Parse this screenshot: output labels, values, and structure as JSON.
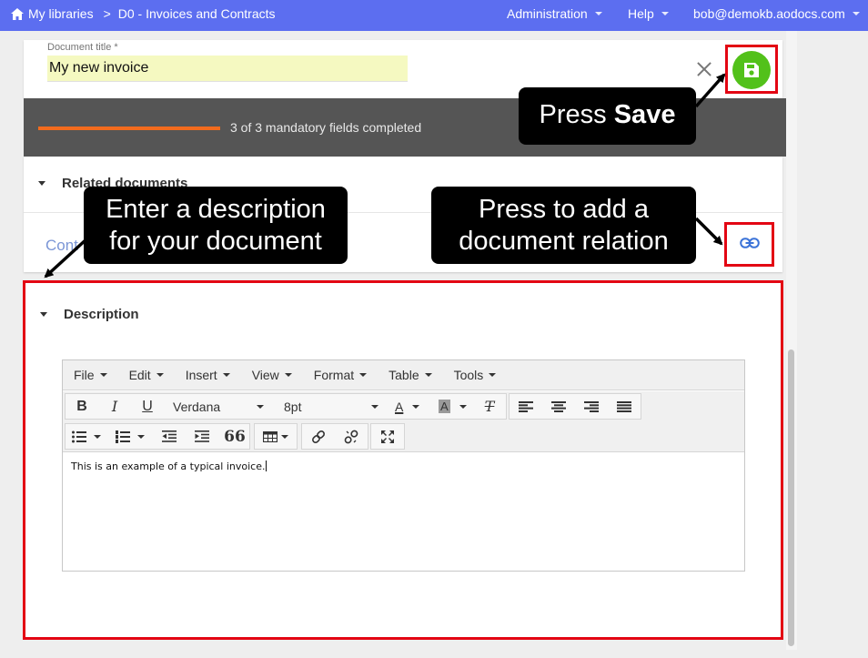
{
  "topbar": {
    "breadcrumb_home": "My libraries",
    "breadcrumb_separator": ">",
    "breadcrumb_library": "D0 - Invoices and Contracts",
    "nav_administration": "Administration",
    "nav_help": "Help",
    "user_email": "bob@demokb.aodocs.com"
  },
  "document": {
    "title_label": "Document title *",
    "title_value": "My new invoice"
  },
  "progress": {
    "text": "3 of 3 mandatory fields completed",
    "completed": 3,
    "total": 3,
    "fill_color": "#f26b1d"
  },
  "related": {
    "heading": "Related documents",
    "link_text": "Cont"
  },
  "description": {
    "heading": "Description",
    "content": "This is an example of a typical invoice."
  },
  "editor": {
    "menu": [
      "File",
      "Edit",
      "Insert",
      "View",
      "Format",
      "Table",
      "Tools"
    ],
    "font_family": "Verdana",
    "font_size": "8pt",
    "bold": "B",
    "italic": "I",
    "underline": "U",
    "text_color_glyph": "A",
    "bg_color_glyph": "A",
    "clear_format_glyph": "T",
    "quote_glyph": "66"
  },
  "callouts": {
    "save_prefix": "Press ",
    "save_bold": "Save",
    "relation_line1": "Press to add a",
    "relation_line2": "document relation",
    "desc_line1": "Enter a description",
    "desc_line2": "for your document"
  },
  "colors": {
    "topbar": "#5c6ef0",
    "highlight_border": "#e30613",
    "save_button": "#52c11a",
    "title_field_bg": "#f5f9c1",
    "link_icon": "#3b73d8"
  },
  "icons": {
    "home": "home-icon",
    "save": "floppy-disk-icon",
    "close": "close-icon",
    "link": "link-icon"
  }
}
